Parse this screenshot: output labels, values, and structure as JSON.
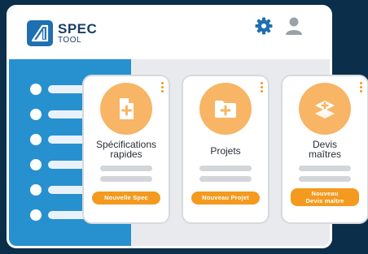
{
  "logo": {
    "line1": "SPEC",
    "line2": "TOOL"
  },
  "colors": {
    "accent": "#f39a1f",
    "primary": "#2790cf",
    "background": "#0b2e4a"
  },
  "header_icons": [
    "gear-icon",
    "user-icon"
  ],
  "sidebar": {
    "item_count": 6
  },
  "cards": [
    {
      "title_line1": "Spécifications",
      "title_line2": "rapides",
      "icon": "file-plus-icon",
      "button": "Nouvelle Spec"
    },
    {
      "title_line1": "Projets",
      "title_line2": "",
      "icon": "folder-plus-icon",
      "button": "Nouveau Projet"
    },
    {
      "title_line1": "Devis",
      "title_line2": "maîtres",
      "icon": "layers-plus-icon",
      "button_line1": "Nouveau",
      "button_line2": "Devis maître"
    }
  ]
}
